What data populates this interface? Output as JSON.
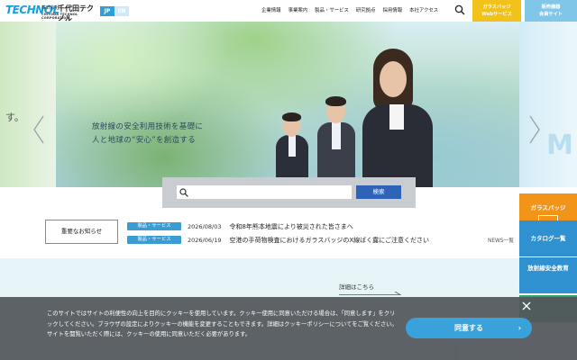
{
  "header": {
    "logo_mark": "TECHNOL",
    "company_prefix": "株式会社",
    "company_name": "千代田テクノル",
    "company_en": "CHIYODA TECHNOL CORPORATION",
    "lang_jp": "JP",
    "lang_en": "EN",
    "nav": [
      "企業情報",
      "事業案内",
      "製品・サービス",
      "研究拠点",
      "採用情報",
      "本社アクセス"
    ],
    "glass_line1": "ガラスバッジ",
    "glass_line2": "Webサービス",
    "member_line1": "販売機器",
    "member_line2": "会員サイト"
  },
  "hero": {
    "prev_slide_text": "す。",
    "tagline_line1": "放射線の安全利用技術を基礎に",
    "tagline_line2": "人と地球の“安心”を創造する",
    "next_slide_letter": "M"
  },
  "search": {
    "placeholder": "",
    "button_label": "検索"
  },
  "news": {
    "label": "重要なお知らせ",
    "items": [
      {
        "tag": "製品・サービス",
        "date": "2026/08/03",
        "title": "令和8年熊本地震により被災された皆さまへ"
      },
      {
        "tag": "製品・サービス",
        "date": "2026/06/19",
        "title": "空港の手荷物検査におけるガラスバッジのX線ばく露にご注意ください"
      }
    ],
    "all_link": "NEWS一覧"
  },
  "detail_link": "詳細はこちら",
  "side_buttons": {
    "glass": "ガラスバッジ",
    "glass_sub": "",
    "catalog": "カタログ一覧",
    "edu": "放射線安全教育"
  },
  "cookie": {
    "text": "このサイトではサイトの利便性の向上を目的にクッキーを使用しています。クッキー使用に同意いただける場合は、「同意します」をクリックしてください。ブラウザの設定によりクッキーの機能を変更することもできます。詳細はクッキーポリシーについてをご覧ください。サイトを閲覧いただく際には、クッキーの使用に同意いただく必要があります。",
    "agree_label": "同意する"
  },
  "colors": {
    "accent_blue": "#2e63b8",
    "tag_blue": "#3b9bd3",
    "glass_yellow": "#f3c21a",
    "side_orange": "#f29418"
  }
}
